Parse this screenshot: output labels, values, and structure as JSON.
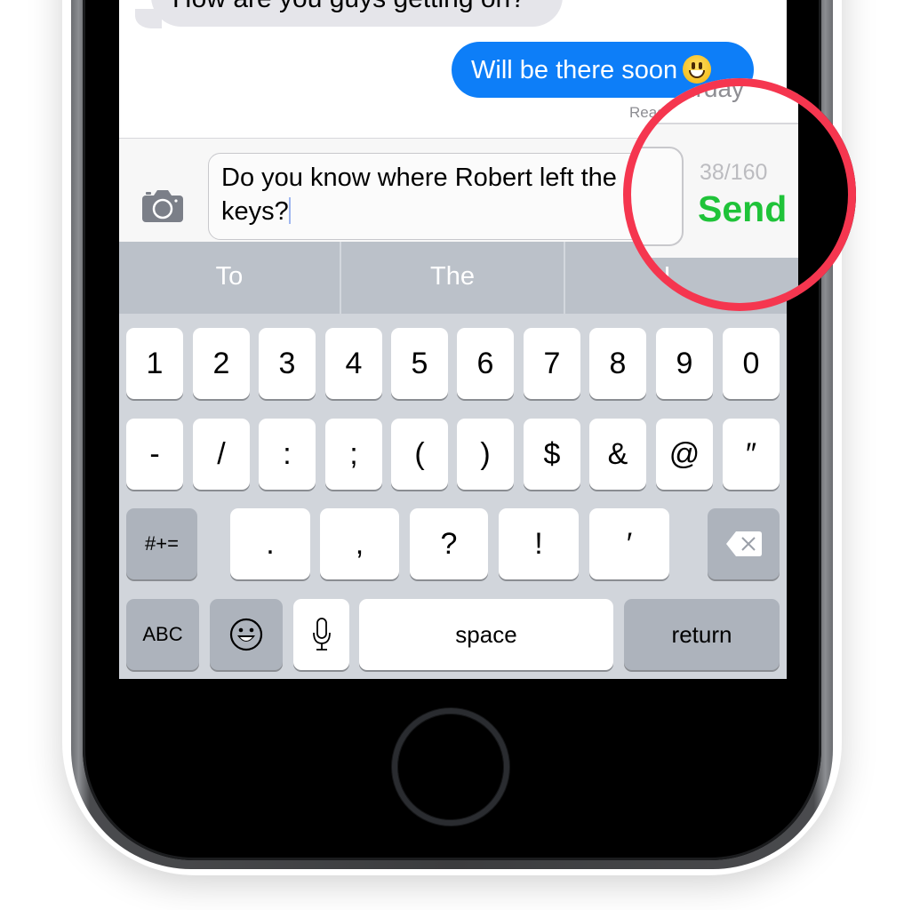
{
  "conversation": {
    "incoming_message": "How are you guys getting on?",
    "outgoing_message": "Will be there soon",
    "outgoing_emoji": "smiley-face-emoji",
    "read_receipt": "Read Saturday"
  },
  "composer": {
    "camera_icon": "camera-icon",
    "message_text": "Do you know where Robert left the keys?",
    "character_count": "38/160",
    "send_label": "Send",
    "send_color": "#1fc339"
  },
  "predictive_bar": {
    "suggestions": [
      "To",
      "The",
      "I"
    ]
  },
  "keyboard": {
    "row1": [
      "1",
      "2",
      "3",
      "4",
      "5",
      "6",
      "7",
      "8",
      "9",
      "0"
    ],
    "row2": [
      "-",
      "/",
      ":",
      ";",
      "(",
      ")",
      "$",
      "&",
      "@",
      "″"
    ],
    "row3": {
      "shift_label": "#+=",
      "keys": [
        ".",
        ",",
        "?",
        "!",
        "′"
      ],
      "delete_icon": "backspace-icon"
    },
    "row4": {
      "abc_label": "ABC",
      "emoji_icon": "emoji-icon",
      "mic_icon": "microphone-icon",
      "space_label": "space",
      "return_label": "return"
    }
  },
  "annotation": {
    "highlight_color": "#f5364f",
    "target": "Send button and character counter"
  }
}
